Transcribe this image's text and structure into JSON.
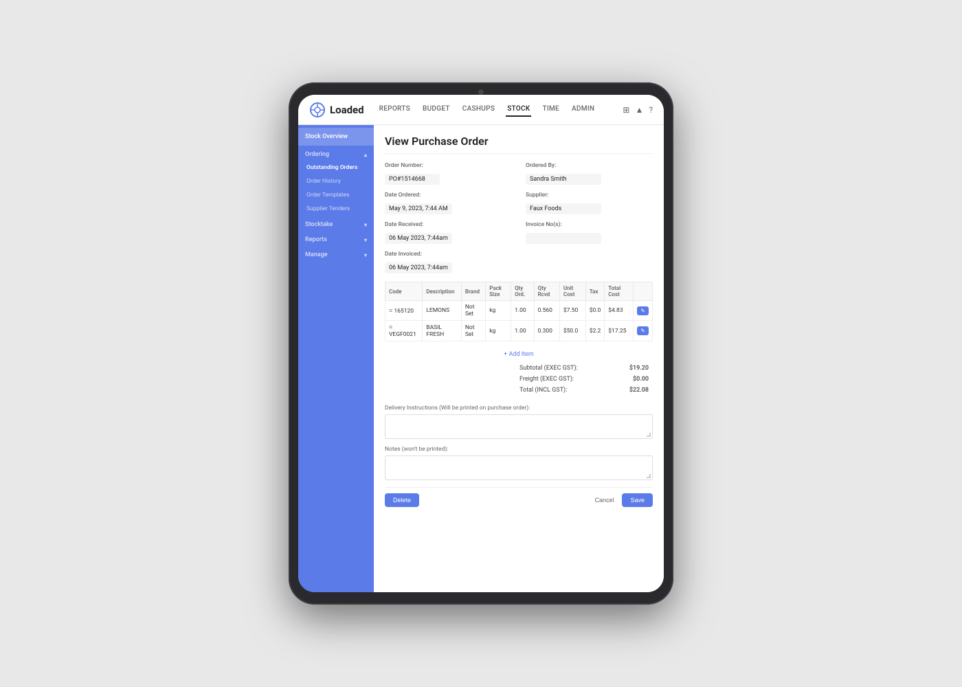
{
  "app": {
    "logo_text": "Loaded",
    "nav_items": [
      "REPORTS",
      "BUDGET",
      "CASHUPS",
      "STOCK",
      "TIME",
      "ADMIN"
    ],
    "active_nav": "STOCK"
  },
  "sidebar": {
    "stock_overview_label": "Stock Overview",
    "ordering_label": "Ordering",
    "ordering_sub": [
      {
        "label": "Outstanding Orders",
        "active": true
      },
      {
        "label": "Order History",
        "active": false
      },
      {
        "label": "Order Templates",
        "active": false
      },
      {
        "label": "Supplier Tenders",
        "active": false
      }
    ],
    "stocktake_label": "Stocktake",
    "reports_label": "Reports",
    "manage_label": "Manage"
  },
  "page": {
    "title": "View Purchase Order",
    "order_number_label": "Order Number:",
    "order_number_value": "PO#1514668",
    "ordered_by_label": "Ordered By:",
    "ordered_by_value": "Sandra Smith",
    "date_ordered_label": "Date Ordered:",
    "date_ordered_value": "May 9, 2023, 7:44 AM",
    "supplier_label": "Supplier:",
    "supplier_value": "Faux Foods",
    "date_received_label": "Date Received:",
    "date_received_value": "06 May 2023, 7:44am",
    "invoice_nos_label": "Invoice No(s):",
    "invoice_nos_value": "",
    "date_invoiced_label": "Date Invoiced:",
    "date_invoiced_value": "06 May 2023, 7:44am",
    "table": {
      "columns": [
        "Code",
        "Description",
        "Brand",
        "Pack Size",
        "Qty Ord.",
        "Qty Rcvd",
        "Unit Cost",
        "Tax",
        "Total Cost"
      ],
      "rows": [
        {
          "code": "165120",
          "description": "LEMONS",
          "brand": "Not Set",
          "pack_size": "kg",
          "qty_ord": "1.00",
          "qty_rcvd": "0.560",
          "unit_cost": "$7.50",
          "tax": "$0.0",
          "total_cost": "$4.83"
        },
        {
          "code": "VEGF0021",
          "description": "BASIL FRESH",
          "brand": "Not Set",
          "pack_size": "kg",
          "qty_ord": "1.00",
          "qty_rcvd": "0.300",
          "unit_cost": "$50.0",
          "tax": "$2.2",
          "total_cost": "$17.25"
        }
      ]
    },
    "add_item_label": "+ Add Item",
    "subtotal_label": "Subtotal (EXEC GST):",
    "subtotal_value": "$19.20",
    "freight_label": "Freight (EXEC GST):",
    "freight_value": "$0.00",
    "total_label": "Total (INCL GST):",
    "total_value": "$22.08",
    "delivery_instructions_label": "Delivery Instructions (Will be printed on purchase order):",
    "notes_label": "Notes (won't be printed):",
    "delete_button": "Delete",
    "cancel_button": "Cancel",
    "save_button": "Save"
  },
  "icons": {
    "logo": "◎",
    "chevron_down": "▾",
    "grid_icon": "⊞",
    "user_icon": "👤",
    "arrow_icon": "›",
    "row_handle": "≡",
    "edit_icon": "✎"
  }
}
